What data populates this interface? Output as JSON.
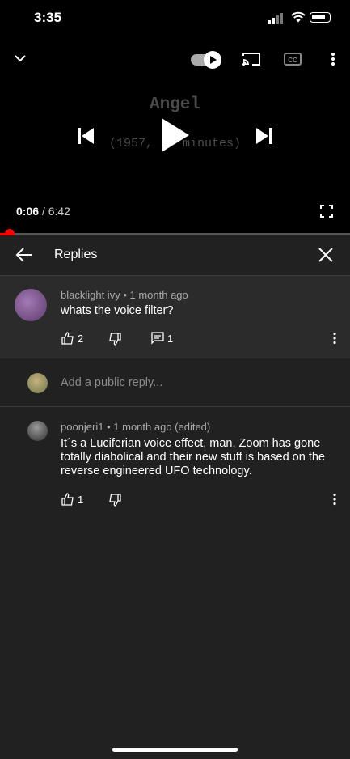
{
  "status_bar": {
    "time": "3:35"
  },
  "player": {
    "video_title": "Angel",
    "video_subtitle": "(1957, ",
    "video_subtitle_tail": "minutes)",
    "current_time": "0:06",
    "separator": " / ",
    "total_time": "6:42",
    "progress_fraction": 0.015
  },
  "replies_panel": {
    "title": "Replies",
    "main_comment": {
      "author": "blacklight ivy",
      "time": "1 month ago",
      "text": "whats the voice filter?",
      "likes": "2",
      "reply_count": "1"
    },
    "reply_input": {
      "placeholder": "Add a public reply..."
    },
    "replies": [
      {
        "author": "poonjeri1",
        "time": "1 month ago (edited)",
        "text": "It´s a Luciferian voice effect, man. Zoom has gone totally diabolical and their new stuff is based on the reverse engineered UFO technology.",
        "likes": "1"
      }
    ]
  },
  "icons": {
    "collapse": "chevron-down-icon",
    "autoplay": "autoplay-toggle-icon",
    "cast": "cast-icon",
    "captions": "cc-icon",
    "more": "more-vert-icon",
    "previous": "skip-previous-icon",
    "play": "play-icon",
    "next": "skip-next-icon",
    "fullscreen": "fullscreen-icon",
    "back": "back-arrow-icon",
    "close": "close-icon",
    "like": "thumb-up-icon",
    "dislike": "thumb-down-icon",
    "replies": "comment-icon"
  },
  "colors": {
    "progress": "#ff0000",
    "background": "#212121",
    "highlight": "#2b2b2b"
  }
}
